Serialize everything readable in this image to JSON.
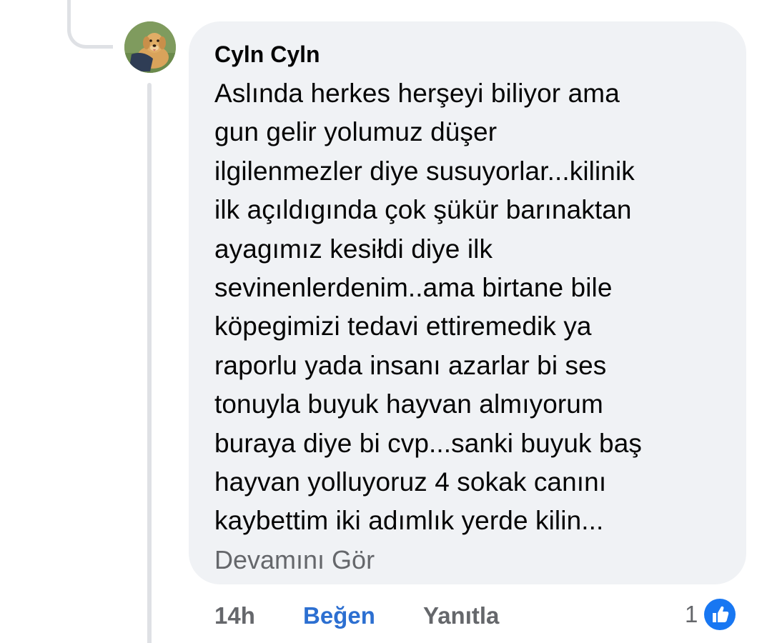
{
  "comment": {
    "author": "Cyln Cyln",
    "text": "Aslında herkes herşeyi biliyor ama\ngun gelir yolumuz düşer\nilgilenmezler diye susuyorlar...kilinik\nilk açıldıgında çok şükür barınaktan\nayagımız kesiłdi diye ilk\nsevinenlerdenim..ama birtane bile\nköpegimizi tedavi ettiremedik ya\nraporlu yada insanı azarlar bi ses\ntonuyla buyuk hayvan almıyorum\nburaya diye bi cvp...sanki buyuk baş\nhayvan yolluyoruz   4 sokak canını\nkaybettim iki adımlık yerde kilin...",
    "see_more": "Devamını Gör"
  },
  "actions": {
    "time": "14h",
    "like": "Beğen",
    "reply": "Yanıtla"
  },
  "reactions": {
    "count": "1",
    "icon": "like-thumb-icon"
  },
  "colors": {
    "bubble": "#f0f2f5",
    "like_blue": "#2c6fd1",
    "muted_text": "#65676b",
    "reaction_blue": "#1877f2"
  }
}
